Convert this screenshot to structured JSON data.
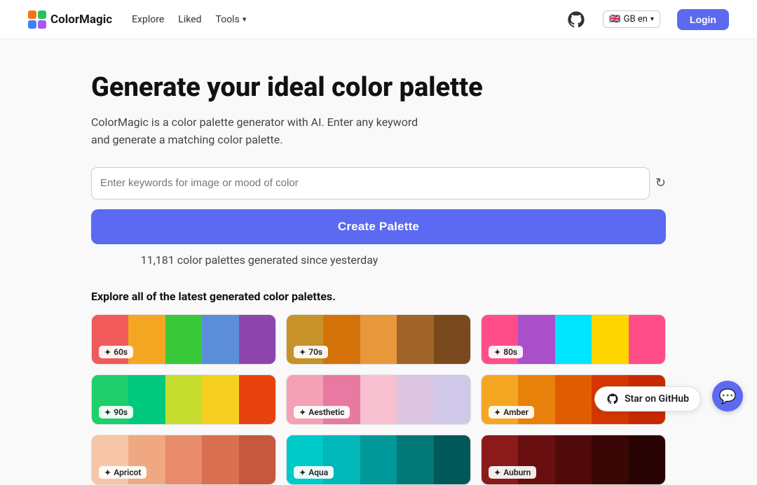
{
  "brand": {
    "name": "ColorMagic",
    "logo_colors": [
      "#f97316",
      "#22c55e",
      "#3b82f6",
      "#a855f7"
    ]
  },
  "nav": {
    "explore_label": "Explore",
    "liked_label": "Liked",
    "tools_label": "Tools",
    "lang_label": "GB en",
    "login_label": "Login"
  },
  "hero": {
    "title": "Generate your ideal color palette",
    "description": "ColorMagic is a color palette generator with AI. Enter any keyword and generate a matching color palette.",
    "search_placeholder": "Enter keywords for image or mood of color",
    "create_button_label": "Create Palette",
    "stats_text": "11,181 color palettes generated since yesterday",
    "refresh_icon": "↻"
  },
  "section": {
    "title": "Explore all of the latest generated color palettes."
  },
  "palettes": [
    {
      "label": "60s",
      "colors": [
        "#f05a5a",
        "#f5a623",
        "#39c939",
        "#5b8dd9",
        "#8e44ad"
      ]
    },
    {
      "label": "70s",
      "colors": [
        "#c8922a",
        "#d4720a",
        "#e8973a",
        "#a0632a",
        "#7a4a1e"
      ]
    },
    {
      "label": "80s",
      "colors": [
        "#ff4d8a",
        "#a84fc9",
        "#00e5ff",
        "#ffd600",
        "#ff4d8a"
      ]
    },
    {
      "label": "90s",
      "colors": [
        "#1ecf6c",
        "#00c97e",
        "#c4dc2e",
        "#f5d020",
        "#e8420e"
      ]
    },
    {
      "label": "Aesthetic",
      "colors": [
        "#f4a0b5",
        "#e879a0",
        "#f7c0d0",
        "#dbc4e0",
        "#d0c8e8"
      ]
    },
    {
      "label": "Amber",
      "colors": [
        "#f5a623",
        "#e8820a",
        "#e05c00",
        "#d43800",
        "#c82a00"
      ]
    },
    {
      "label": "Apricot",
      "colors": [
        "#f7c5a8",
        "#f0a882",
        "#e88b6a",
        "#d97050",
        "#c65840"
      ]
    },
    {
      "label": "Aqua",
      "colors": [
        "#00c9c9",
        "#00b8b8",
        "#009898",
        "#007878",
        "#005858"
      ]
    },
    {
      "label": "Auburn",
      "colors": [
        "#8b1a1a",
        "#6a0f0f",
        "#500a0a",
        "#3a0606",
        "#280303"
      ]
    }
  ],
  "github_star": {
    "label": "Star on GitHub"
  },
  "chat_icon": "💬"
}
